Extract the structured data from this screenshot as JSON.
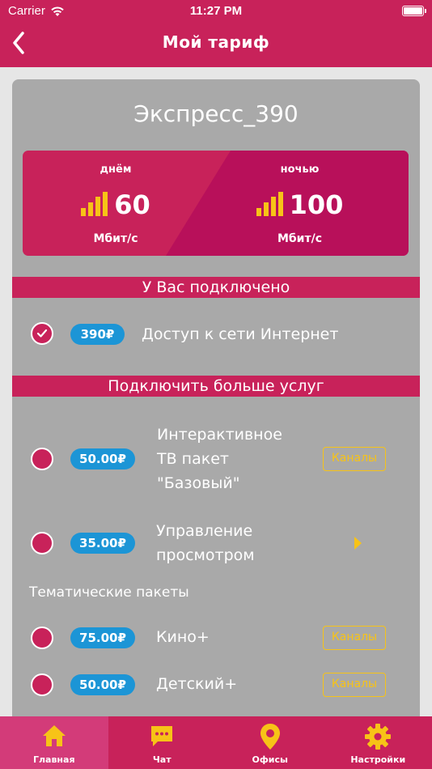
{
  "status_bar": {
    "carrier": "Carrier",
    "time": "11:27 PM"
  },
  "header": {
    "title": "Мой тариф"
  },
  "plan": {
    "name": "Экспресс_390",
    "day": {
      "label": "днём",
      "speed": "60",
      "unit": "Мбит/с"
    },
    "night": {
      "label": "ночью",
      "speed": "100",
      "unit": "Мбит/с"
    }
  },
  "connected": {
    "heading": "У Вас подключено",
    "items": [
      {
        "price": "390₽",
        "name": "Доступ к сети Интернет",
        "checked": true
      }
    ]
  },
  "more": {
    "heading": "Подключить больше услуг",
    "items": [
      {
        "price": "50.00₽",
        "name_lines": [
          "Интерактивное",
          "ТВ пакет",
          "\"Базовый\""
        ],
        "action": "Каналы"
      },
      {
        "price": "35.00₽",
        "name_lines": [
          "Управление",
          "просмотром"
        ]
      }
    ],
    "thematic_heading": "Тематические пакеты",
    "thematic": [
      {
        "price": "75.00₽",
        "name": "Кино+",
        "action": "Каналы"
      },
      {
        "price": "50.00₽",
        "name": "Детский+",
        "action": "Каналы"
      }
    ]
  },
  "tabbar": {
    "tabs": [
      {
        "label": "Главная",
        "icon": "home-icon",
        "active": true
      },
      {
        "label": "Чат",
        "icon": "chat-icon"
      },
      {
        "label": "Офисы",
        "icon": "map-pin-icon"
      },
      {
        "label": "Настройки",
        "icon": "gear-icon"
      }
    ]
  },
  "colors": {
    "brand": "#c8225a",
    "night": "#b8105a",
    "accent": "#f7c317",
    "price_badge": "#1c95d6",
    "card": "#a9a9a9"
  }
}
